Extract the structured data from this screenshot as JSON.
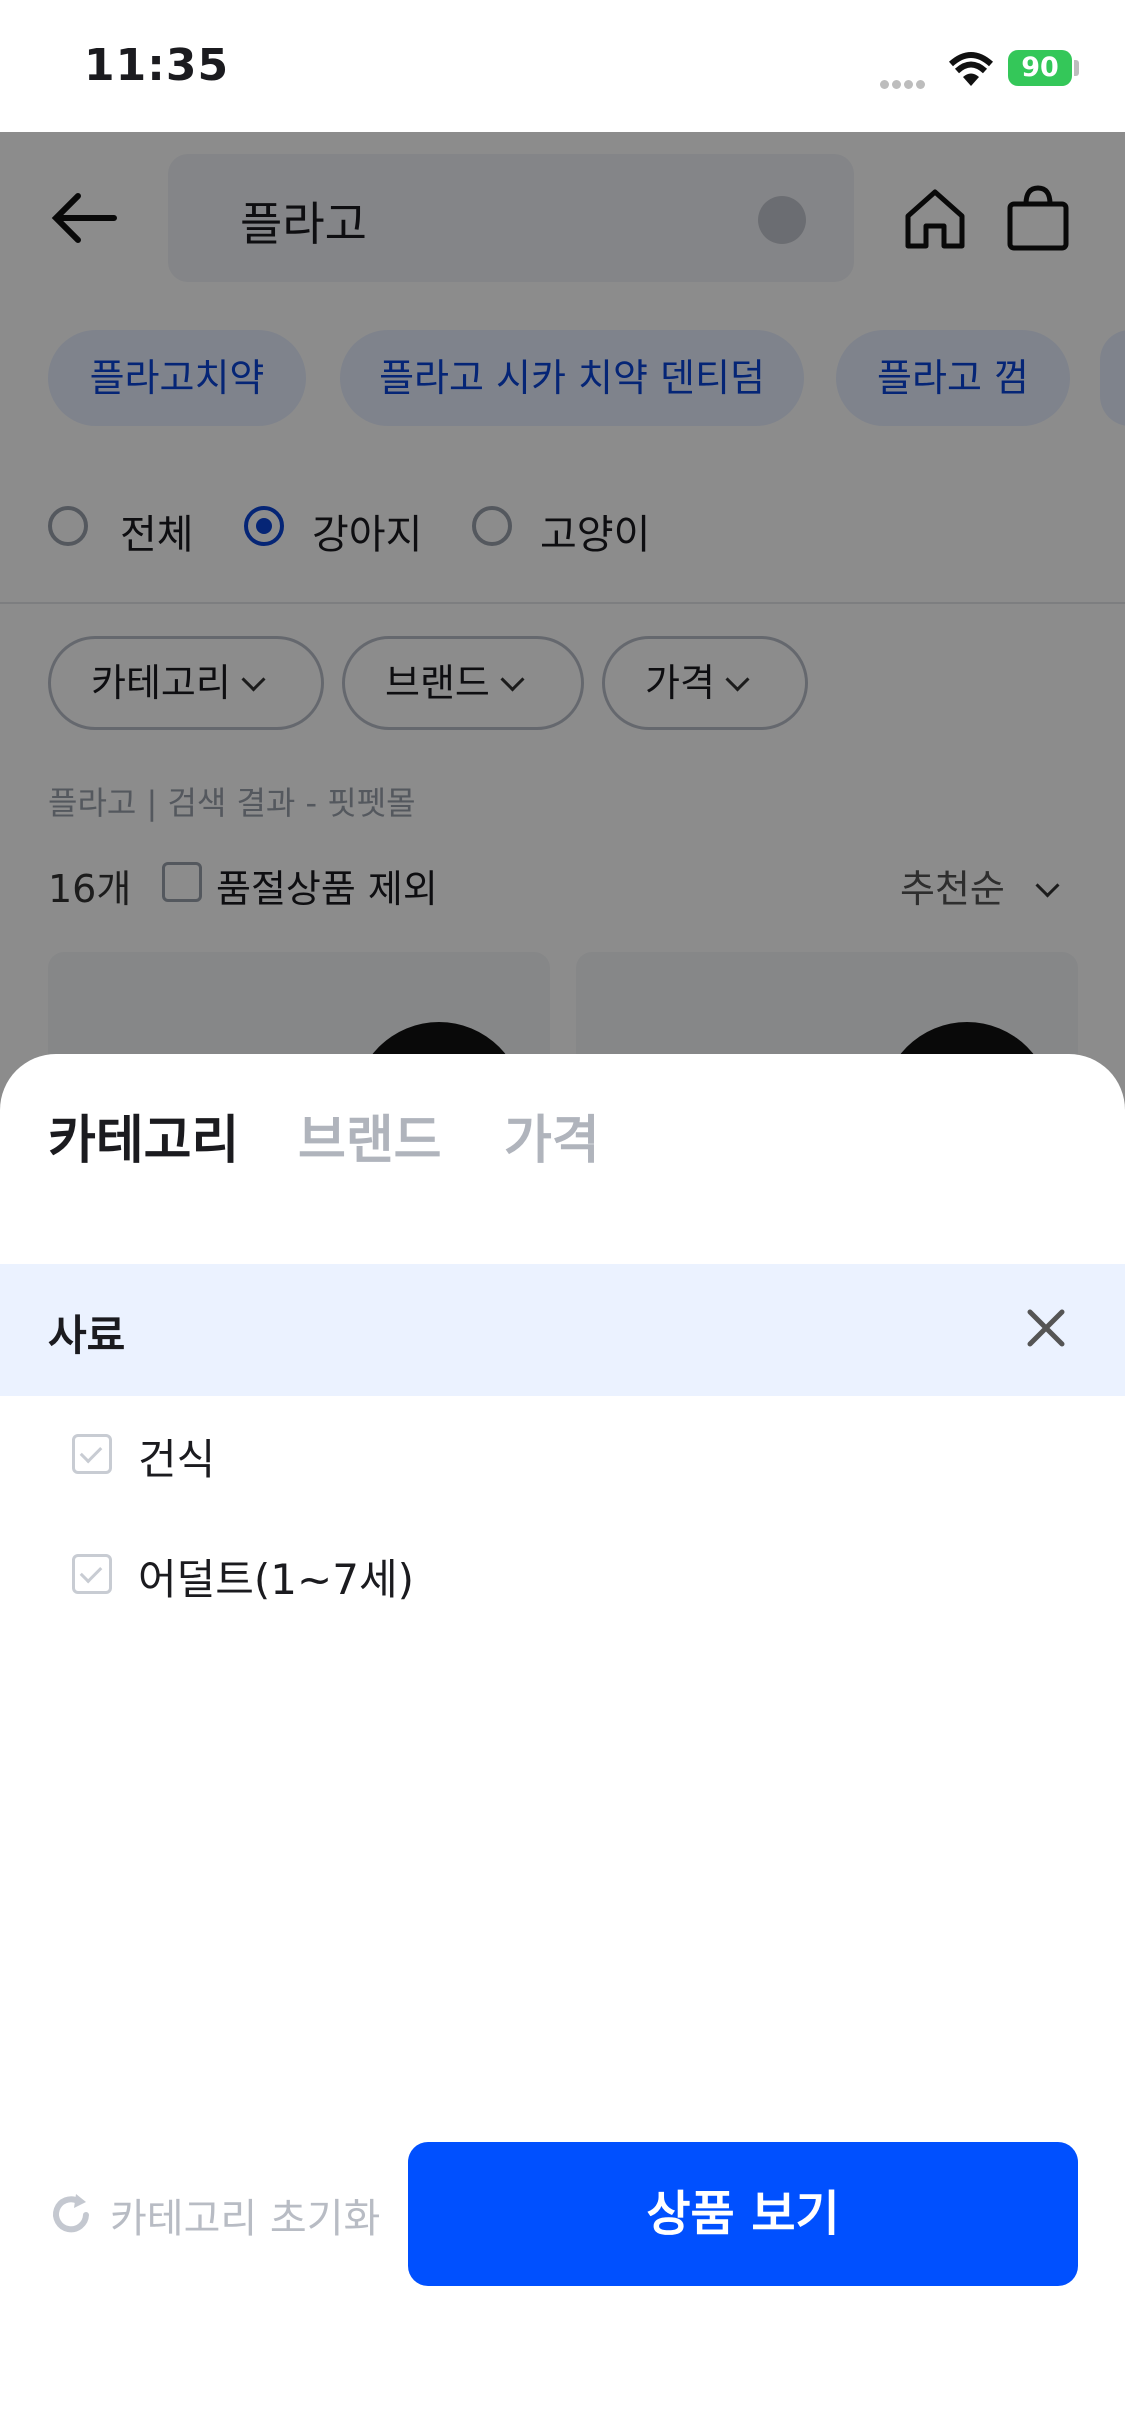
{
  "status_bar": {
    "time": "11:35",
    "battery": "90"
  },
  "search": {
    "query": "플라고"
  },
  "suggestions": [
    "플라고치약",
    "플라고 시카 치약 덴티덤",
    "플라고 껌"
  ],
  "pet_filter": {
    "options": [
      "전체",
      "강아지",
      "고양이"
    ],
    "selected": "강아지"
  },
  "filters": {
    "category": "카테고리",
    "brand": "브랜드",
    "price": "가격"
  },
  "results": {
    "meta": "플라고 | 검색 결과 - 핏펫몰",
    "count": "16개",
    "exclude_soldout": "품절상품 제외",
    "sort": "추천순"
  },
  "sheet": {
    "tabs": [
      "카테고리",
      "브랜드",
      "가격"
    ],
    "active_tab": "카테고리",
    "selected_category": "사료",
    "options": [
      "건식",
      "어덜트(1~7세)"
    ],
    "reset_label": "카테고리 초기화",
    "cta_label": "상품 보기"
  },
  "colors": {
    "accent": "#0050ff",
    "chip_text": "#0a44d8",
    "highlight_bg": "#ebf2ff",
    "battery": "#34c759"
  }
}
